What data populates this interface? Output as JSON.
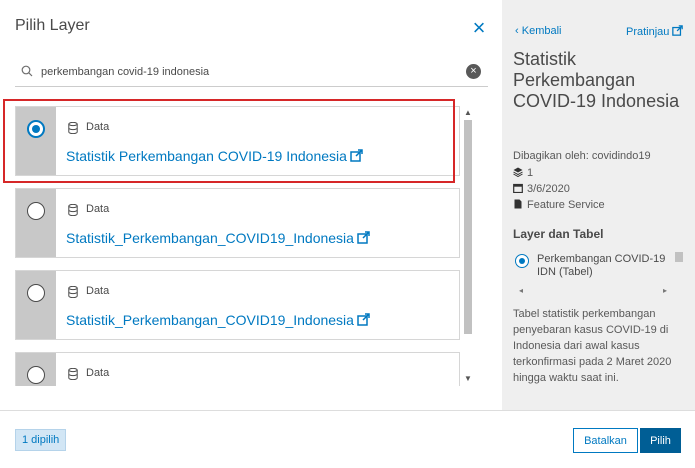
{
  "dialog": {
    "title": "Pilih Layer",
    "close_glyph": "×"
  },
  "search": {
    "value": "perkembangan covid-19 indonesia",
    "placeholder": "",
    "clear_glyph": "×"
  },
  "results": [
    {
      "type_label": "Data",
      "title": "Statistik Perkembangan COVID-19 Indonesia",
      "selected": true
    },
    {
      "type_label": "Data",
      "title": "Statistik_Perkembangan_COVID19_Indonesia",
      "selected": false
    },
    {
      "type_label": "Data",
      "title": "Statistik_Perkembangan_COVID19_Indonesia",
      "selected": false
    },
    {
      "type_label": "Data",
      "title": "",
      "selected": false
    }
  ],
  "details": {
    "back_label": "Kembali",
    "preview_label": "Pratinjau",
    "title": "Statistik Perkembangan COVID-19 Indonesia",
    "shared_by": "Dibagikan oleh: covidindo19",
    "layer_count": "1",
    "date": "3/6/2020",
    "service_type": "Feature Service",
    "section_heading": "Layer dan Tabel",
    "layer_name": "Perkembangan COVID-19 IDN (Tabel)",
    "description": "Tabel statistik perkembangan penyebaran kasus COVID-19 di Indonesia dari awal kasus terkonfirmasi pada 2 Maret 2020 hingga waktu saat ini."
  },
  "footer": {
    "selected_count": "1 dipilih",
    "cancel_label": "Batalkan",
    "select_label": "Pilih"
  },
  "colors": {
    "accent": "#0079c1",
    "primary_button": "#005e95",
    "highlight": "#d62728",
    "rail": "#c8c8c8",
    "details_bg": "#efefef"
  }
}
